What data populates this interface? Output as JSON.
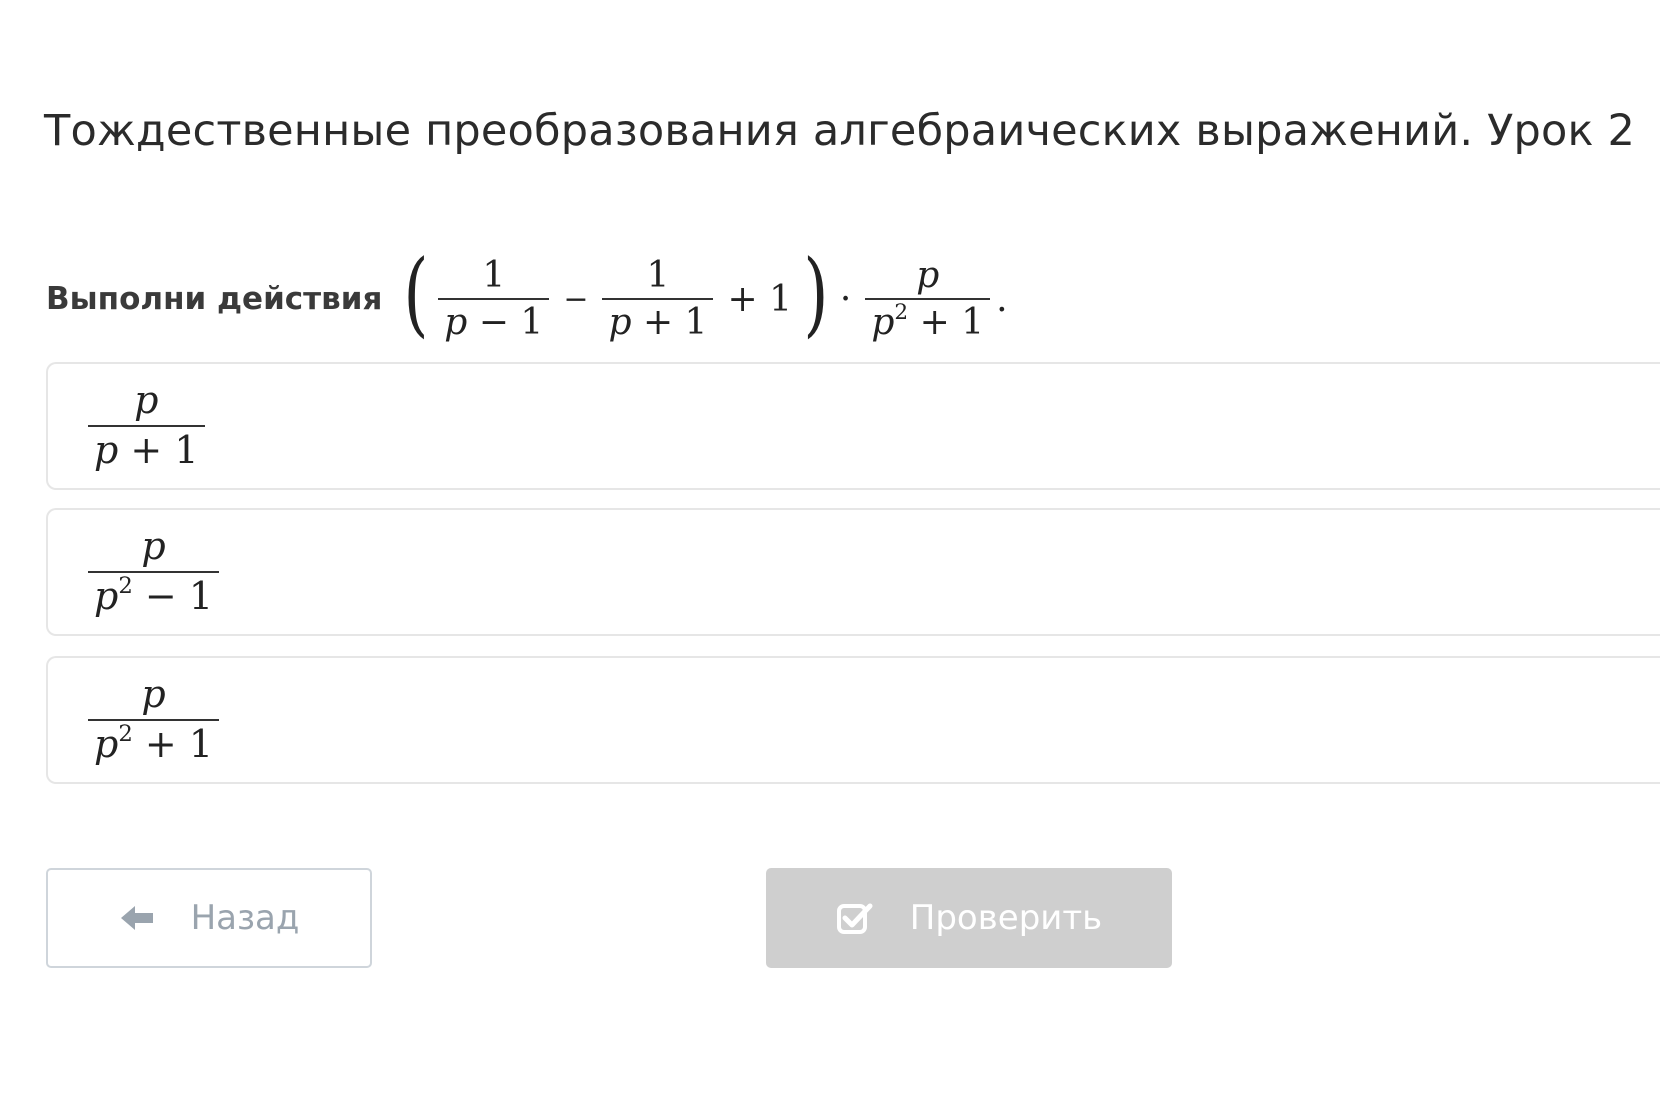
{
  "page": {
    "title": "Тождественные преобразования алгебраических выражений. Урок 2"
  },
  "question": {
    "label": "Выполни действия",
    "expr": {
      "open_paren": "(",
      "close_paren": ")",
      "f1_num": "1",
      "f1_den_var": "p",
      "f1_den_rest": " − 1",
      "minus": "−",
      "f2_num": "1",
      "f2_den_var": "p",
      "f2_den_rest": " + 1",
      "plus_one": "+ 1",
      "dot": "·",
      "f3_num": "p",
      "f3_den_var": "p",
      "f3_den_exp": "2",
      "f3_den_rest": " + 1",
      "period": "."
    }
  },
  "options": [
    {
      "num": "p",
      "den_var": "p",
      "den_exp": "",
      "den_rest": " + 1"
    },
    {
      "num": "p",
      "den_var": "p",
      "den_exp": "2",
      "den_rest": " − 1"
    },
    {
      "num": "p",
      "den_var": "p",
      "den_exp": "2",
      "den_rest": " + 1"
    }
  ],
  "buttons": {
    "back": {
      "label": "Назад",
      "icon": "arrow-left-icon"
    },
    "check": {
      "label": "Проверить",
      "icon": "checkbox-check-icon"
    }
  },
  "colors": {
    "check_button_bg": "#cfcfcf",
    "back_button_border": "#cfd5db",
    "option_border": "#e6e6e6"
  }
}
